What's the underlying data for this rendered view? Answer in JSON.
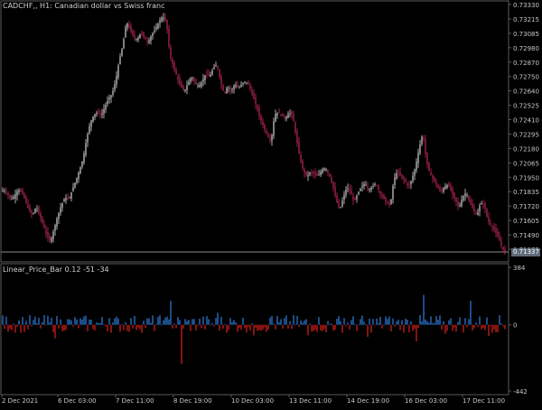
{
  "main_title": "CADCHF,, H1:  Canadian dollar vs Swiss franc",
  "indicator_title": "Linear_Price_Bar 0.12 -51 -34",
  "price_tag": "0.71337",
  "colors": {
    "background": "#000000",
    "grid": "#5a5a5a",
    "axis_text": "#c8c8c8",
    "bull": "#d4d4d4",
    "bear": "#c0285a",
    "hist_pos": "#2e7fe0",
    "hist_neg": "#e0201c"
  },
  "chart_data": [
    {
      "type": "candlestick",
      "title": "CADCHF,, H1:  Canadian dollar vs Swiss franc",
      "yticks": [
        "0.73330",
        "0.73215",
        "0.73085",
        "0.72980",
        "0.72870",
        "0.72750",
        "0.72640",
        "0.72525",
        "0.72410",
        "0.72295",
        "0.72180",
        "0.72065",
        "0.71950",
        "0.71835",
        "0.71720",
        "0.71605",
        "0.71490",
        "0.71375"
      ],
      "ylim": [
        0.7132,
        0.7334
      ],
      "close_path": [
        [
          0,
          0.7186
        ],
        [
          4,
          0.7188
        ],
        [
          8,
          0.7185
        ],
        [
          12,
          0.718
        ],
        [
          16,
          0.7183
        ],
        [
          20,
          0.7188
        ],
        [
          24,
          0.7186
        ],
        [
          28,
          0.718
        ],
        [
          32,
          0.7172
        ],
        [
          36,
          0.7168
        ],
        [
          40,
          0.7175
        ],
        [
          44,
          0.7168
        ],
        [
          48,
          0.716
        ],
        [
          52,
          0.7152
        ],
        [
          56,
          0.7148
        ],
        [
          60,
          0.7158
        ],
        [
          64,
          0.7168
        ],
        [
          68,
          0.7176
        ],
        [
          72,
          0.7182
        ],
        [
          76,
          0.718
        ],
        [
          80,
          0.7188
        ],
        [
          84,
          0.7195
        ],
        [
          88,
          0.7203
        ],
        [
          92,
          0.7212
        ],
        [
          96,
          0.7228
        ],
        [
          100,
          0.724
        ],
        [
          104,
          0.7246
        ],
        [
          108,
          0.7248
        ],
        [
          112,
          0.7245
        ],
        [
          116,
          0.7252
        ],
        [
          120,
          0.7258
        ],
        [
          124,
          0.7262
        ],
        [
          128,
          0.7272
        ],
        [
          132,
          0.7288
        ],
        [
          136,
          0.73
        ],
        [
          140,
          0.7318
        ],
        [
          144,
          0.7312
        ],
        [
          148,
          0.7306
        ],
        [
          152,
          0.7304
        ],
        [
          156,
          0.731
        ],
        [
          160,
          0.7305
        ],
        [
          164,
          0.7302
        ],
        [
          168,
          0.7308
        ],
        [
          172,
          0.7312
        ],
        [
          176,
          0.7318
        ],
        [
          180,
          0.7322
        ],
        [
          184,
          0.7318
        ],
        [
          188,
          0.7292
        ],
        [
          192,
          0.7283
        ],
        [
          196,
          0.7275
        ],
        [
          200,
          0.7268
        ],
        [
          204,
          0.7264
        ],
        [
          208,
          0.727
        ],
        [
          212,
          0.7276
        ],
        [
          216,
          0.727
        ],
        [
          220,
          0.7268
        ],
        [
          224,
          0.7272
        ],
        [
          228,
          0.7278
        ],
        [
          232,
          0.7275
        ],
        [
          236,
          0.7282
        ],
        [
          240,
          0.7285
        ],
        [
          244,
          0.7272
        ],
        [
          248,
          0.7262
        ],
        [
          252,
          0.7268
        ],
        [
          256,
          0.7264
        ],
        [
          260,
          0.727
        ],
        [
          264,
          0.7266
        ],
        [
          268,
          0.727
        ],
        [
          272,
          0.7272
        ],
        [
          276,
          0.7268
        ],
        [
          280,
          0.726
        ],
        [
          284,
          0.7252
        ],
        [
          288,
          0.7243
        ],
        [
          292,
          0.7236
        ],
        [
          296,
          0.723
        ],
        [
          300,
          0.7225
        ],
        [
          304,
          0.7246
        ],
        [
          308,
          0.7248
        ],
        [
          312,
          0.7245
        ],
        [
          316,
          0.7243
        ],
        [
          320,
          0.7248
        ],
        [
          324,
          0.7245
        ],
        [
          328,
          0.7228
        ],
        [
          332,
          0.7212
        ],
        [
          336,
          0.7202
        ],
        [
          340,
          0.7198
        ],
        [
          344,
          0.7202
        ],
        [
          348,
          0.72
        ],
        [
          352,
          0.7198
        ],
        [
          356,
          0.7203
        ],
        [
          360,
          0.7205
        ],
        [
          364,
          0.72
        ],
        [
          368,
          0.7192
        ],
        [
          372,
          0.718
        ],
        [
          376,
          0.7172
        ],
        [
          380,
          0.7182
        ],
        [
          384,
          0.719
        ],
        [
          388,
          0.7186
        ],
        [
          392,
          0.7178
        ],
        [
          396,
          0.7185
        ],
        [
          400,
          0.719
        ],
        [
          404,
          0.7193
        ],
        [
          408,
          0.7188
        ],
        [
          412,
          0.719
        ],
        [
          416,
          0.7193
        ],
        [
          420,
          0.7186
        ],
        [
          424,
          0.7182
        ],
        [
          428,
          0.7178
        ],
        [
          432,
          0.7175
        ],
        [
          436,
          0.7196
        ],
        [
          440,
          0.7202
        ],
        [
          444,
          0.7198
        ],
        [
          448,
          0.7195
        ],
        [
          452,
          0.719
        ],
        [
          456,
          0.7196
        ],
        [
          460,
          0.7206
        ],
        [
          464,
          0.722
        ],
        [
          468,
          0.7232
        ],
        [
          472,
          0.721
        ],
        [
          476,
          0.72
        ],
        [
          480,
          0.7196
        ],
        [
          484,
          0.719
        ],
        [
          488,
          0.7186
        ],
        [
          492,
          0.719
        ],
        [
          496,
          0.7192
        ],
        [
          500,
          0.7186
        ],
        [
          504,
          0.718
        ],
        [
          508,
          0.7174
        ],
        [
          512,
          0.7182
        ],
        [
          516,
          0.7186
        ],
        [
          520,
          0.7178
        ],
        [
          524,
          0.7172
        ],
        [
          528,
          0.7168
        ],
        [
          532,
          0.7178
        ],
        [
          536,
          0.7176
        ],
        [
          540,
          0.7164
        ],
        [
          544,
          0.716
        ],
        [
          548,
          0.7156
        ],
        [
          552,
          0.715
        ],
        [
          556,
          0.7143
        ],
        [
          560,
          0.7137
        ]
      ]
    },
    {
      "type": "bar",
      "title": "Linear_Price_Bar 0.12 -51 -34",
      "yticks": [
        "384",
        "0",
        "-442"
      ],
      "ylim": [
        -442,
        384
      ],
      "xticks": [
        "2 Dec 2021",
        "6 Dec 03:00",
        "7 Dec 11:00",
        "8 Dec 19:00",
        "10 Dec 03:00",
        "13 Dec 11:00",
        "14 Dec 19:00",
        "16 Dec 03:00",
        "17 Dec 11:00"
      ],
      "bars": [
        [
          60,
          -90
        ],
        [
          70,
          -40
        ],
        [
          95,
          130
        ],
        [
          120,
          45
        ],
        [
          150,
          -35
        ],
        [
          180,
          30
        ],
        [
          188,
          160
        ],
        [
          200,
          -260
        ],
        [
          240,
          80
        ],
        [
          280,
          -70
        ],
        [
          300,
          60
        ],
        [
          312,
          -25
        ],
        [
          340,
          -70
        ],
        [
          360,
          -50
        ],
        [
          380,
          45
        ],
        [
          406,
          -80
        ],
        [
          426,
          55
        ],
        [
          460,
          -110
        ],
        [
          468,
          200
        ],
        [
          492,
          -60
        ],
        [
          520,
          160
        ],
        [
          540,
          -75
        ]
      ]
    }
  ]
}
